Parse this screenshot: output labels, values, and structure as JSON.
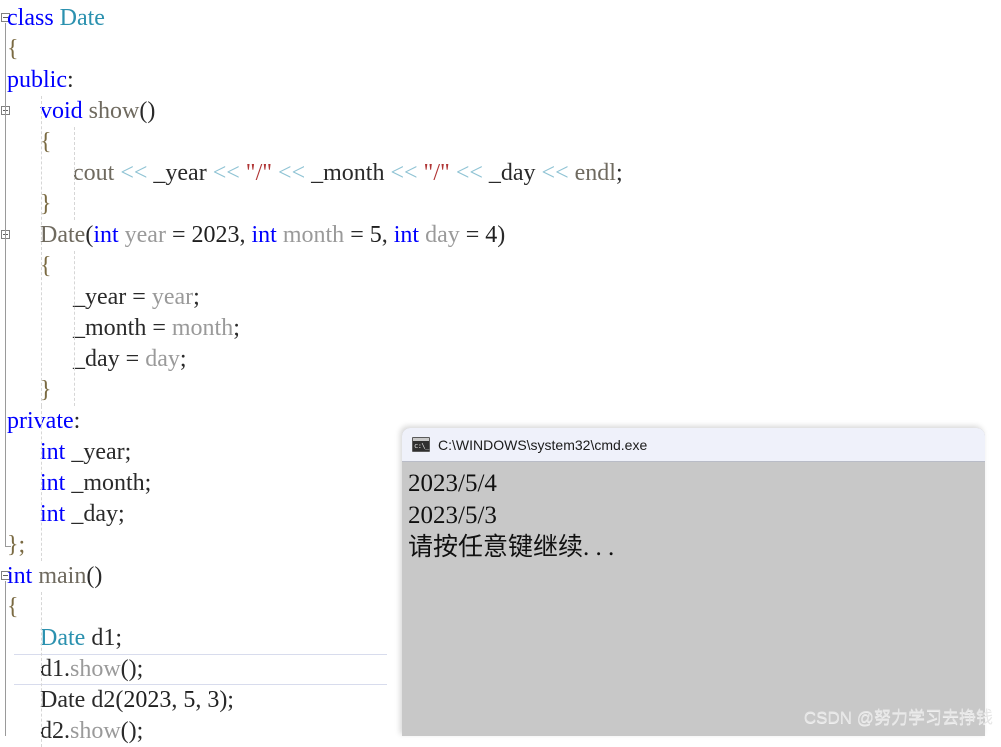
{
  "editor": {
    "name": "code-editor",
    "language": "cpp",
    "font_size_px": 24,
    "line_height_px": 31,
    "colors": {
      "background": "#ffffff",
      "keyword": "#0000ff",
      "type": "#2b91af",
      "function": "#6f6a5f",
      "variable": "#9a9a9a",
      "operator": "#8fc3d4",
      "string": "#b03535",
      "plain": "#2a2a2a",
      "current_line_border": "#d8dced",
      "indent_guide": "#d6d6d6",
      "fold_marker": "#808080"
    },
    "current_line_number": 22,
    "lines": [
      {
        "n": 1,
        "indent": 0,
        "tokens": [
          {
            "t": "class",
            "c": "kw"
          },
          {
            "t": " ",
            "c": "pln"
          },
          {
            "t": "Date",
            "c": "type"
          }
        ]
      },
      {
        "n": 2,
        "indent": 0,
        "tokens": [
          {
            "t": "{",
            "c": "punc"
          }
        ]
      },
      {
        "n": 3,
        "indent": 0,
        "tokens": [
          {
            "t": "public",
            "c": "kw"
          },
          {
            "t": ":",
            "c": "pln"
          }
        ]
      },
      {
        "n": 4,
        "indent": 1,
        "tokens": [
          {
            "t": "void",
            "c": "kw"
          },
          {
            "t": " ",
            "c": "pln"
          },
          {
            "t": "show",
            "c": "fn"
          },
          {
            "t": "()",
            "c": "pln"
          }
        ]
      },
      {
        "n": 5,
        "indent": 1,
        "tokens": [
          {
            "t": "{",
            "c": "punc"
          }
        ]
      },
      {
        "n": 6,
        "indent": 2,
        "tokens": [
          {
            "t": "cout",
            "c": "fn"
          },
          {
            "t": " ",
            "c": "pln"
          },
          {
            "t": "<<",
            "c": "op"
          },
          {
            "t": " _year ",
            "c": "pln"
          },
          {
            "t": "<<",
            "c": "op"
          },
          {
            "t": " ",
            "c": "pln"
          },
          {
            "t": "\"/\"",
            "c": "str"
          },
          {
            "t": " ",
            "c": "pln"
          },
          {
            "t": "<<",
            "c": "op"
          },
          {
            "t": " _month ",
            "c": "pln"
          },
          {
            "t": "<<",
            "c": "op"
          },
          {
            "t": " ",
            "c": "pln"
          },
          {
            "t": "\"/\"",
            "c": "str"
          },
          {
            "t": " ",
            "c": "pln"
          },
          {
            "t": "<<",
            "c": "op"
          },
          {
            "t": " _day ",
            "c": "pln"
          },
          {
            "t": "<<",
            "c": "op"
          },
          {
            "t": " ",
            "c": "pln"
          },
          {
            "t": "endl",
            "c": "fn"
          },
          {
            "t": ";",
            "c": "pln"
          }
        ]
      },
      {
        "n": 7,
        "indent": 1,
        "tokens": [
          {
            "t": "}",
            "c": "punc"
          }
        ]
      },
      {
        "n": 8,
        "indent": 1,
        "tokens": [
          {
            "t": "Date",
            "c": "fn"
          },
          {
            "t": "(",
            "c": "pln"
          },
          {
            "t": "int",
            "c": "kw"
          },
          {
            "t": " ",
            "c": "pln"
          },
          {
            "t": "year",
            "c": "var"
          },
          {
            "t": " = ",
            "c": "pln"
          },
          {
            "t": "2023",
            "c": "num"
          },
          {
            "t": ", ",
            "c": "pln"
          },
          {
            "t": "int",
            "c": "kw"
          },
          {
            "t": " ",
            "c": "pln"
          },
          {
            "t": "month",
            "c": "var"
          },
          {
            "t": " = ",
            "c": "pln"
          },
          {
            "t": "5",
            "c": "num"
          },
          {
            "t": ", ",
            "c": "pln"
          },
          {
            "t": "int",
            "c": "kw"
          },
          {
            "t": " ",
            "c": "pln"
          },
          {
            "t": "day",
            "c": "var"
          },
          {
            "t": " = ",
            "c": "pln"
          },
          {
            "t": "4",
            "c": "num"
          },
          {
            "t": ")",
            "c": "pln"
          }
        ]
      },
      {
        "n": 9,
        "indent": 1,
        "tokens": [
          {
            "t": "{",
            "c": "punc"
          }
        ]
      },
      {
        "n": 10,
        "indent": 2,
        "tokens": [
          {
            "t": "_year",
            "c": "pln"
          },
          {
            "t": " = ",
            "c": "pln"
          },
          {
            "t": "year",
            "c": "var"
          },
          {
            "t": ";",
            "c": "pln"
          }
        ]
      },
      {
        "n": 11,
        "indent": 2,
        "tokens": [
          {
            "t": "_month",
            "c": "pln"
          },
          {
            "t": " = ",
            "c": "pln"
          },
          {
            "t": "month",
            "c": "var"
          },
          {
            "t": ";",
            "c": "pln"
          }
        ]
      },
      {
        "n": 12,
        "indent": 2,
        "tokens": [
          {
            "t": "_day",
            "c": "pln"
          },
          {
            "t": " = ",
            "c": "pln"
          },
          {
            "t": "day",
            "c": "var"
          },
          {
            "t": ";",
            "c": "pln"
          }
        ]
      },
      {
        "n": 13,
        "indent": 1,
        "tokens": [
          {
            "t": "}",
            "c": "punc"
          }
        ]
      },
      {
        "n": 14,
        "indent": 0,
        "tokens": [
          {
            "t": "private",
            "c": "kw"
          },
          {
            "t": ":",
            "c": "pln"
          }
        ]
      },
      {
        "n": 15,
        "indent": 1,
        "tokens": [
          {
            "t": "int",
            "c": "kw"
          },
          {
            "t": " _year;",
            "c": "pln"
          }
        ]
      },
      {
        "n": 16,
        "indent": 1,
        "tokens": [
          {
            "t": "int",
            "c": "kw"
          },
          {
            "t": " _month;",
            "c": "pln"
          }
        ]
      },
      {
        "n": 17,
        "indent": 1,
        "tokens": [
          {
            "t": "int",
            "c": "kw"
          },
          {
            "t": " _day;",
            "c": "pln"
          }
        ]
      },
      {
        "n": 18,
        "indent": 0,
        "tokens": [
          {
            "t": "};",
            "c": "punc"
          }
        ]
      },
      {
        "n": 19,
        "indent": 0,
        "tokens": [
          {
            "t": "int",
            "c": "kw"
          },
          {
            "t": " ",
            "c": "pln"
          },
          {
            "t": "main",
            "c": "fn"
          },
          {
            "t": "()",
            "c": "pln"
          }
        ]
      },
      {
        "n": 20,
        "indent": 0,
        "tokens": [
          {
            "t": "{",
            "c": "punc"
          }
        ]
      },
      {
        "n": 21,
        "indent": 1,
        "tokens": [
          {
            "t": "Date",
            "c": "type"
          },
          {
            "t": " d1;",
            "c": "pln"
          }
        ]
      },
      {
        "n": 22,
        "indent": 1,
        "tokens": [
          {
            "t": "d1.",
            "c": "pln"
          },
          {
            "t": "show",
            "c": "var"
          },
          {
            "t": "();",
            "c": "pln"
          }
        ]
      },
      {
        "n": 23,
        "indent": 1,
        "tokens": [
          {
            "t": "Date",
            "c": "pln"
          },
          {
            "t": " d2(",
            "c": "pln"
          },
          {
            "t": "2023",
            "c": "num"
          },
          {
            "t": ", ",
            "c": "pln"
          },
          {
            "t": "5",
            "c": "num"
          },
          {
            "t": ", ",
            "c": "pln"
          },
          {
            "t": "3",
            "c": "num"
          },
          {
            "t": ");",
            "c": "pln"
          }
        ]
      },
      {
        "n": 24,
        "indent": 1,
        "tokens": [
          {
            "t": "d2.",
            "c": "pln"
          },
          {
            "t": "show",
            "c": "var"
          },
          {
            "t": "();",
            "c": "pln"
          }
        ]
      }
    ],
    "fold_markers": [
      {
        "name": "fold-marker-class-date",
        "line": 1
      },
      {
        "name": "fold-marker-show-method",
        "line": 4
      },
      {
        "name": "fold-marker-date-ctor",
        "line": 8
      },
      {
        "name": "fold-marker-main",
        "line": 19
      }
    ]
  },
  "console": {
    "name": "cmd-console-window",
    "title": "C:\\WINDOWS\\system32\\cmd.exe",
    "icon": "cmd-icon",
    "background": "#c8c8c8",
    "titlebar_background": "#eff1fa",
    "output_lines": [
      "2023/5/4",
      "2023/5/3",
      "请按任意键继续. . ."
    ]
  },
  "watermark": {
    "name": "csdn-watermark",
    "text": "CSDN @努力学习去挣钱",
    "color": "#e6e6e6"
  }
}
